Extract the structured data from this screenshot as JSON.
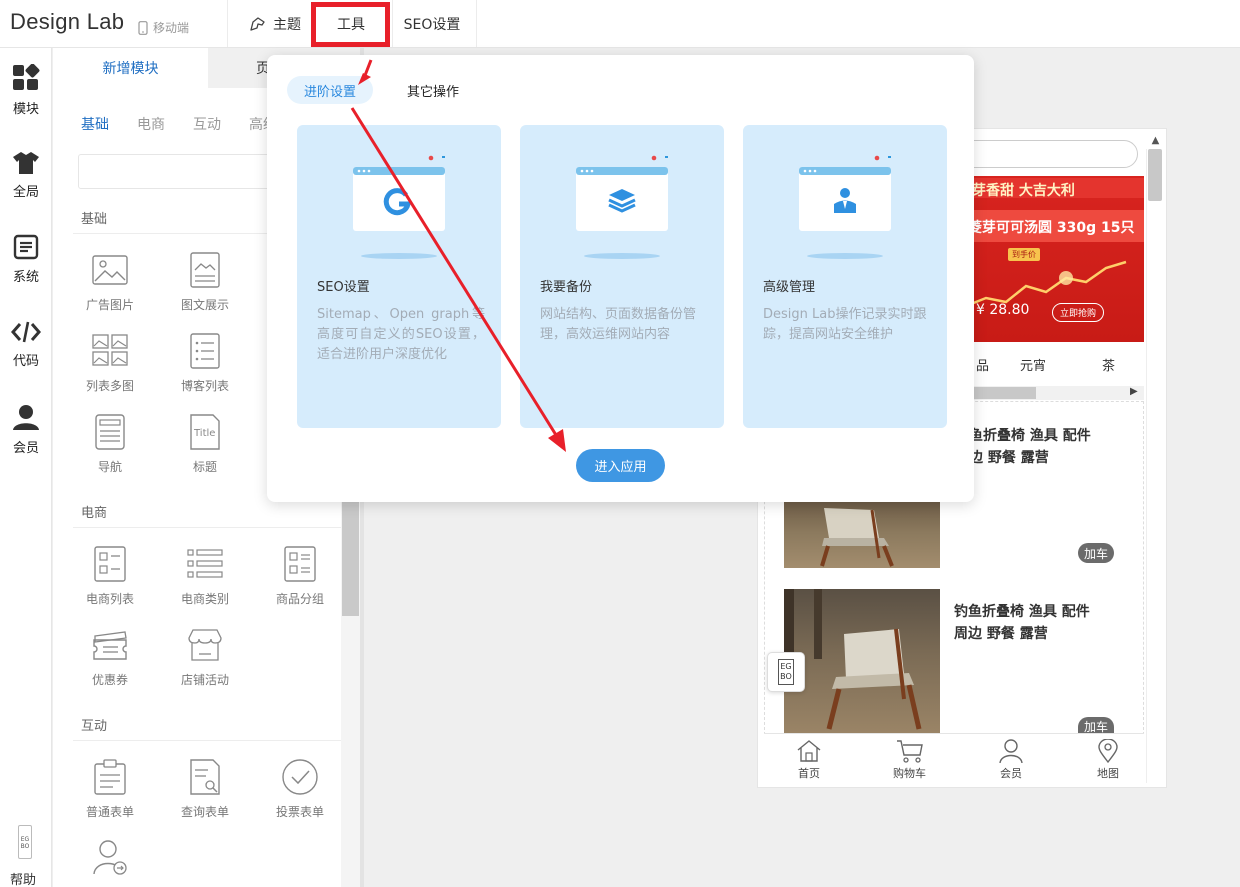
{
  "header": {
    "logo": "Design Lab",
    "mobile": "移动端",
    "theme": "主题",
    "tools": "工具",
    "seo": "SEO设置"
  },
  "rail": [
    {
      "label": "模块",
      "icon": "modules-icon"
    },
    {
      "label": "全局",
      "icon": "shirt-icon"
    },
    {
      "label": "系统",
      "icon": "document-icon"
    },
    {
      "label": "代码",
      "icon": "code-icon"
    },
    {
      "label": "会员",
      "icon": "user-icon"
    }
  ],
  "rail_help": "帮助",
  "panel": {
    "tab_new": "新增模块",
    "tab_page": "页",
    "categories": [
      "基础",
      "电商",
      "互动",
      "高级"
    ],
    "sections": {
      "basic": {
        "title": "基础",
        "items": [
          "广告图片",
          "图文展示",
          "列表多图",
          "博客列表",
          "导航",
          "标题"
        ]
      },
      "ecom": {
        "title": "电商",
        "items": [
          "电商列表",
          "电商类别",
          "商品分组",
          "优惠券",
          "店铺活动"
        ]
      },
      "interact": {
        "title": "互动",
        "items": [
          "普通表单",
          "查询表单",
          "投票表单"
        ]
      }
    }
  },
  "popover": {
    "tabs": [
      "进阶设置",
      "其它操作"
    ],
    "cards": [
      {
        "title": "SEO设置",
        "desc": "Sitemap、Open graph等高度可自定义的SEO设置，适合进阶用户深度优化",
        "icon": "google-icon"
      },
      {
        "title": "我要备份",
        "desc": "网站结构、页面数据备份管理，高效运维网站内容",
        "icon": "layers-icon"
      },
      {
        "title": "高级管理",
        "desc": "Design Lab操作记录实时跟踪，提高网站安全维护",
        "icon": "person-icon"
      }
    ],
    "enter_button": "进入应用"
  },
  "phone": {
    "banner": {
      "line1": "芽香甜 大吉大利",
      "line2": "菱芽可可汤圆 330g 15只",
      "tag": "到手价",
      "price": "¥ 28.80",
      "cta": "立即抢购"
    },
    "cat_tabs": [
      "品",
      "元宵",
      "茶"
    ],
    "products": [
      {
        "title_line1": "鱼折叠椅 渔具 配件",
        "title_line2": "边 野餐 露营",
        "cart": "加车"
      },
      {
        "title_line1": "钓鱼折叠椅 渔具 配件",
        "title_line2": "周边 野餐 露营",
        "cart": "加车"
      }
    ],
    "bottom_nav": [
      "首页",
      "购物车",
      "会员",
      "地图"
    ]
  },
  "colors": {
    "accent": "#2b89de",
    "highlight": "#e8202a",
    "card_bg": "#d6ecfc",
    "button": "#3f97e3"
  }
}
